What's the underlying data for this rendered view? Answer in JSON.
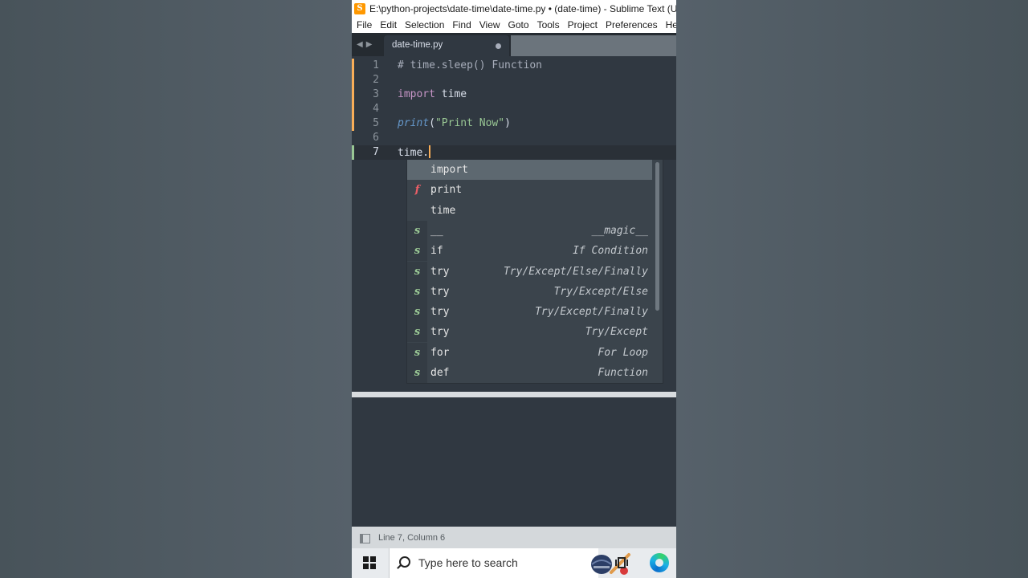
{
  "window": {
    "title": "E:\\python-projects\\date-time\\date-time.py • (date-time) - Sublime Text (UNREGISTERED)"
  },
  "menu": [
    "File",
    "Edit",
    "Selection",
    "Find",
    "View",
    "Goto",
    "Tools",
    "Project",
    "Preferences",
    "Help"
  ],
  "tab": {
    "label": "date-time.py"
  },
  "editor": {
    "lines": [
      {
        "num": "1",
        "comment": "# time.sleep() Function"
      },
      {
        "num": "2"
      },
      {
        "num": "3",
        "keyword": "import",
        "rest": " time"
      },
      {
        "num": "4"
      },
      {
        "num": "5",
        "func": "print",
        "open": "(",
        "string": "\"Print Now\"",
        "close": ")"
      },
      {
        "num": "6"
      },
      {
        "num": "7",
        "text": "time."
      }
    ]
  },
  "autocomplete": [
    {
      "kind": "",
      "trigger": "import",
      "annotation": ""
    },
    {
      "kind": "f",
      "trigger": "print",
      "annotation": ""
    },
    {
      "kind": "",
      "trigger": "time",
      "annotation": ""
    },
    {
      "kind": "s",
      "trigger": "__",
      "annotation": "__magic__"
    },
    {
      "kind": "s",
      "trigger": "if",
      "annotation": "If Condition"
    },
    {
      "kind": "s",
      "trigger": "try",
      "annotation": "Try/Except/Else/Finally"
    },
    {
      "kind": "s",
      "trigger": "try",
      "annotation": "Try/Except/Else"
    },
    {
      "kind": "s",
      "trigger": "try",
      "annotation": "Try/Except/Finally"
    },
    {
      "kind": "s",
      "trigger": "try",
      "annotation": "Try/Except"
    },
    {
      "kind": "s",
      "trigger": "for",
      "annotation": "For Loop"
    },
    {
      "kind": "s",
      "trigger": "def",
      "annotation": "Function"
    }
  ],
  "status": {
    "position": "Line 7, Column 6"
  },
  "taskbar": {
    "search_placeholder": "Type here to search"
  },
  "colors": {
    "editor_bg": "#303841",
    "keyword": "#c695c6",
    "function": "#6699cc",
    "string": "#99c794",
    "snippet_kind": "#99c794",
    "function_kind": "#ec5f67",
    "modified_gutter": "#f9ae58",
    "active_gutter": "#99c794"
  },
  "icons": {
    "app": "sublime-text-icon",
    "tab_nav": [
      "chevron-left-icon",
      "chevron-right-icon"
    ],
    "tab_modified": "modified-dot-icon",
    "status": "sidebar-toggle-icon",
    "taskbar": [
      "windows-start-icon",
      "search-icon",
      "cricket-news-icon",
      "task-view-icon",
      "edge-browser-icon"
    ]
  }
}
